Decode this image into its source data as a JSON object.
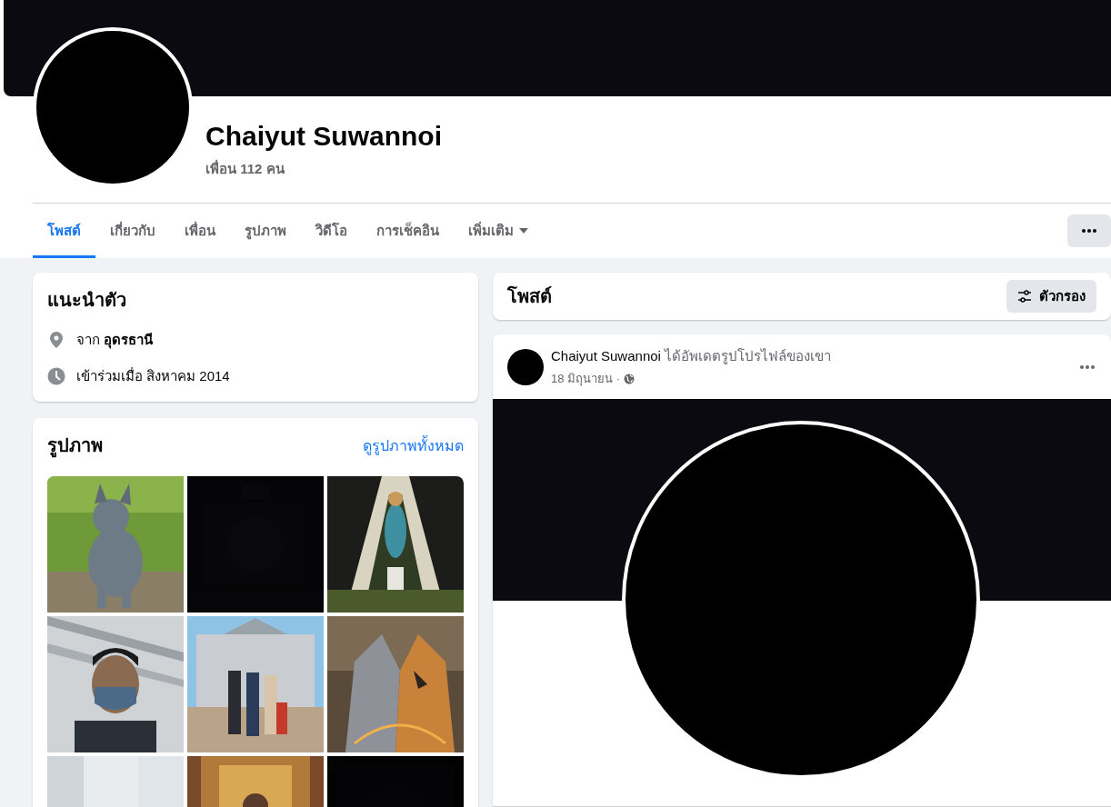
{
  "profile": {
    "name": "Chaiyut Suwannoi",
    "friends": "เพื่อน 112 คน"
  },
  "tabs": [
    {
      "label": "โพสต์",
      "selected": true,
      "dropdown": false
    },
    {
      "label": "เกี่ยวกับ",
      "selected": false,
      "dropdown": false
    },
    {
      "label": "เพื่อน",
      "selected": false,
      "dropdown": false
    },
    {
      "label": "รูปภาพ",
      "selected": false,
      "dropdown": false
    },
    {
      "label": "วิดีโอ",
      "selected": false,
      "dropdown": false
    },
    {
      "label": "การเช็คอิน",
      "selected": false,
      "dropdown": false
    },
    {
      "label": "เพิ่มเติม",
      "selected": false,
      "dropdown": true
    }
  ],
  "intro": {
    "title": "แนะนำตัว",
    "items": [
      {
        "kind": "location",
        "text": "จาก **อุดรธานี**"
      },
      {
        "kind": "joined",
        "text": "เข้าร่วมเมื่อ สิงหาคม 2014"
      }
    ]
  },
  "photos": {
    "title": "รูปภาพ",
    "link": "ดูรูปภาพทั้งหมด"
  },
  "posts_header": {
    "title": "โพสต์",
    "filter": "ตัวกรอง"
  },
  "post": {
    "author": "Chaiyut Suwannoi",
    "action": "ได้อัพเดตรูปโปรไฟล์ของเขา",
    "date": "18 มิถุนายน ·"
  }
}
